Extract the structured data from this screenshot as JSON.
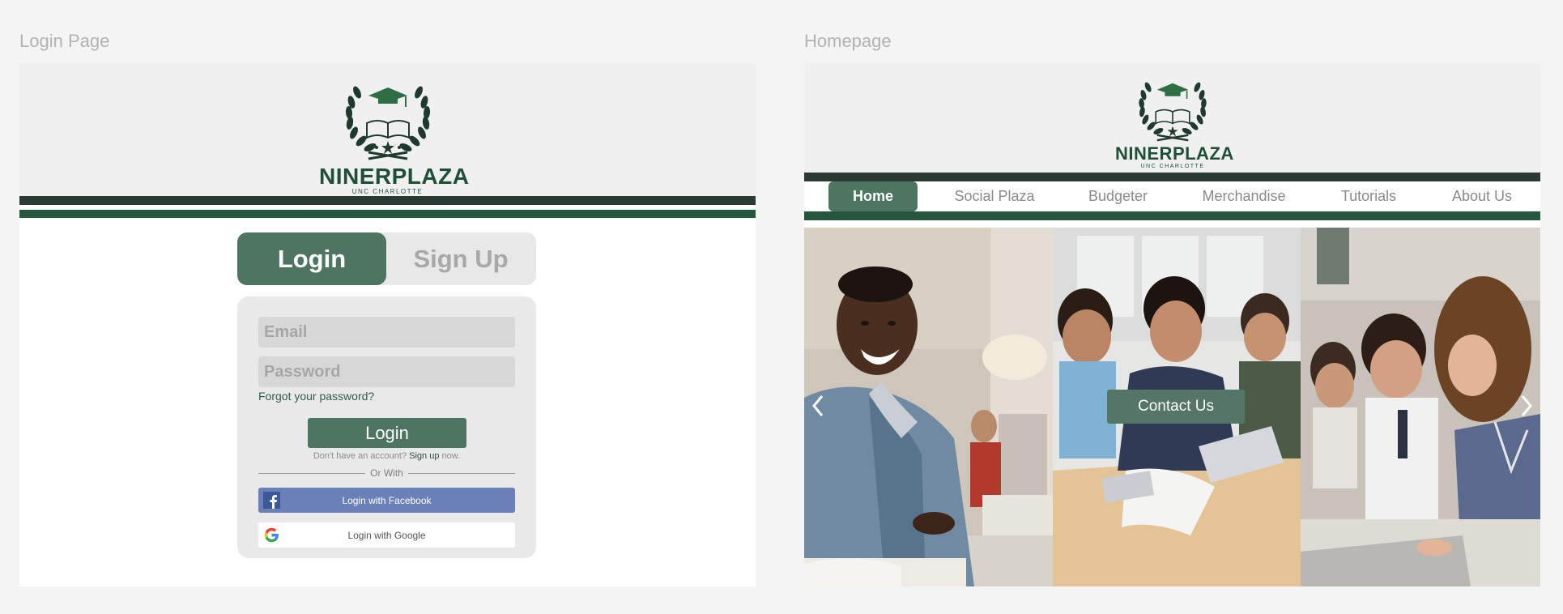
{
  "frames": {
    "login_label": "Login Page",
    "home_label": "Homepage"
  },
  "brand": {
    "title": "NINERPLAZA",
    "subtitle": "UNC CHARLOTTE",
    "green": "#1f4f36",
    "accent": "#4e7462"
  },
  "login": {
    "tabs": {
      "login": "Login",
      "signup": "Sign Up",
      "active": "login"
    },
    "email_placeholder": "Email",
    "password_placeholder": "Password",
    "forgot": "Forgot your password?",
    "submit": "Login",
    "no_account_prefix": "Don't have an account?",
    "signup_link": "Sign up",
    "no_account_suffix": "now.",
    "or_with": "Or With",
    "facebook": "Login with Facebook",
    "google": "Login with Google"
  },
  "home": {
    "nav": [
      "Home",
      "Social Plaza",
      "Budgeter",
      "Merchandise",
      "Tutorials",
      "About Us"
    ],
    "active_nav": "Home",
    "contact": "Contact Us",
    "icons": [
      "chevron-left-icon",
      "chevron-right-icon"
    ]
  }
}
